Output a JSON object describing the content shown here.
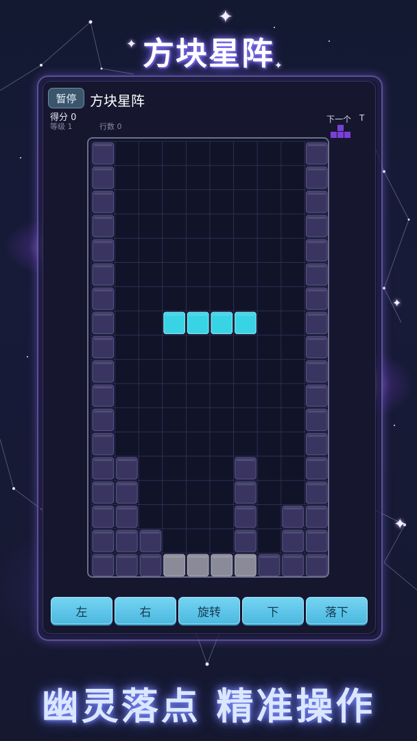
{
  "app": {
    "title_logo": "方块星阵",
    "slogan": "幽灵落点 精准操作"
  },
  "hud": {
    "pause_label": "暂停",
    "game_name": "方块星阵",
    "score_text": "得分 0",
    "level_text": "等级 1",
    "lines_text": "行数 0",
    "next_label": "下一个",
    "next_type": "T"
  },
  "board": {
    "cols": 10,
    "rows": 18,
    "filled_color": "#3a3560",
    "active_color": "#38d4e6",
    "ghost_color": "#8a8a98",
    "next_color": "#7b3fd6",
    "active_piece": {
      "type": "I",
      "cells": [
        [
          3,
          7
        ],
        [
          4,
          7
        ],
        [
          5,
          7
        ],
        [
          6,
          7
        ]
      ]
    },
    "ghost_piece": {
      "cells": [
        [
          3,
          17
        ],
        [
          4,
          17
        ],
        [
          5,
          17
        ],
        [
          6,
          17
        ]
      ]
    },
    "filled_cells": [
      [
        0,
        0
      ],
      [
        9,
        0
      ],
      [
        0,
        1
      ],
      [
        9,
        1
      ],
      [
        0,
        2
      ],
      [
        9,
        2
      ],
      [
        0,
        3
      ],
      [
        9,
        3
      ],
      [
        0,
        4
      ],
      [
        9,
        4
      ],
      [
        0,
        5
      ],
      [
        9,
        5
      ],
      [
        0,
        6
      ],
      [
        9,
        6
      ],
      [
        0,
        7
      ],
      [
        9,
        7
      ],
      [
        0,
        8
      ],
      [
        9,
        8
      ],
      [
        0,
        9
      ],
      [
        9,
        9
      ],
      [
        0,
        10
      ],
      [
        9,
        10
      ],
      [
        0,
        11
      ],
      [
        9,
        11
      ],
      [
        0,
        12
      ],
      [
        9,
        12
      ],
      [
        0,
        13
      ],
      [
        1,
        13
      ],
      [
        6,
        13
      ],
      [
        9,
        13
      ],
      [
        0,
        14
      ],
      [
        1,
        14
      ],
      [
        6,
        14
      ],
      [
        9,
        14
      ],
      [
        0,
        15
      ],
      [
        1,
        15
      ],
      [
        6,
        15
      ],
      [
        8,
        15
      ],
      [
        9,
        15
      ],
      [
        0,
        16
      ],
      [
        1,
        16
      ],
      [
        2,
        16
      ],
      [
        6,
        16
      ],
      [
        8,
        16
      ],
      [
        9,
        16
      ],
      [
        0,
        17
      ],
      [
        1,
        17
      ],
      [
        2,
        17
      ],
      [
        7,
        17
      ],
      [
        8,
        17
      ],
      [
        9,
        17
      ]
    ],
    "next_cells": [
      [
        1,
        0
      ],
      [
        0,
        1
      ],
      [
        1,
        1
      ],
      [
        2,
        1
      ]
    ]
  },
  "controls": [
    {
      "label": "左",
      "name": "left-button"
    },
    {
      "label": "右",
      "name": "right-button"
    },
    {
      "label": "旋转",
      "name": "rotate-button"
    },
    {
      "label": "下",
      "name": "down-button"
    },
    {
      "label": "落下",
      "name": "drop-button"
    }
  ]
}
